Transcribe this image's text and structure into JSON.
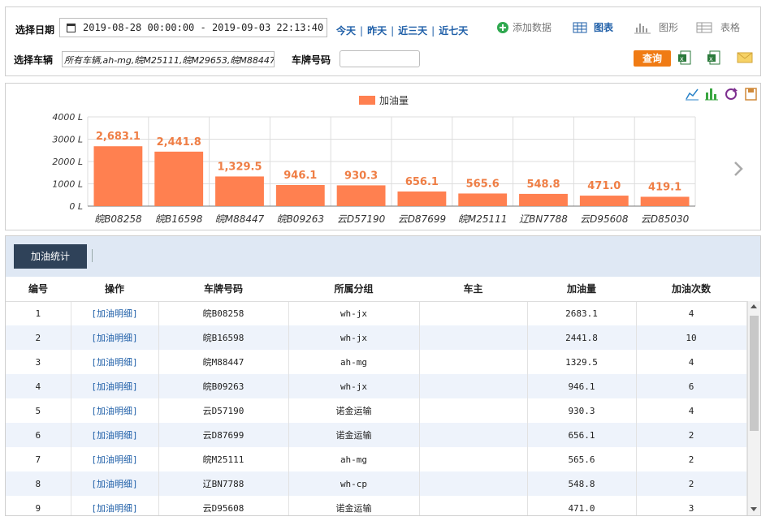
{
  "filter": {
    "date_label": "选择日期",
    "date_range": "2019-08-28 00:00:00 - 2019-09-03 22:13:40",
    "quick": [
      "今天",
      "昨天",
      "近三天",
      "近七天"
    ],
    "add_data": "添加数据",
    "chart_btn": "图表",
    "graph_btn": "图形",
    "table_btn": "表格",
    "vehicle_label": "选择车辆",
    "vehicle_value": "所有车辆,ah-mg,皖M25111,皖M29653,皖M88447",
    "plate_label": "车牌号码",
    "plate_value": "",
    "query": "查询"
  },
  "chart_data": {
    "type": "bar",
    "series": [
      {
        "name": "加油量",
        "values": [
          2683.1,
          2441.8,
          1329.5,
          946.1,
          930.3,
          656.1,
          565.6,
          548.8,
          471.0,
          419.1
        ]
      }
    ],
    "categories": [
      "皖B08258",
      "皖B16598",
      "皖M88447",
      "皖B09263",
      "云D57190",
      "云D87699",
      "皖M25111",
      "辽BN7788",
      "云D95608",
      "云D85030"
    ],
    "value_labels": [
      "2,683.1",
      "2,441.8",
      "1,329.5",
      "946.1",
      "930.3",
      "656.1",
      "565.6",
      "548.8",
      "471.0",
      "419.1"
    ],
    "yticks": [
      "0 L",
      "1000 L",
      "2000 L",
      "3000 L",
      "4000 L"
    ],
    "ylim": [
      0,
      4000
    ],
    "legend_position": "top-center",
    "bar_color": "#ff8050",
    "grid": true
  },
  "table": {
    "tab": "加油统计",
    "headers": [
      "编号",
      "操作",
      "车牌号码",
      "所属分组",
      "车主",
      "加油量",
      "加油次数"
    ],
    "rows": [
      [
        "1",
        "[加油明细]",
        "皖B08258",
        "wh-jx",
        "",
        "2683.1",
        "4"
      ],
      [
        "2",
        "[加油明细]",
        "皖B16598",
        "wh-jx",
        "",
        "2441.8",
        "10"
      ],
      [
        "3",
        "[加油明细]",
        "皖M88447",
        "ah-mg",
        "",
        "1329.5",
        "4"
      ],
      [
        "4",
        "[加油明细]",
        "皖B09263",
        "wh-jx",
        "",
        "946.1",
        "6"
      ],
      [
        "5",
        "[加油明细]",
        "云D57190",
        "诺金运输",
        "",
        "930.3",
        "4"
      ],
      [
        "6",
        "[加油明细]",
        "云D87699",
        "诺金运输",
        "",
        "656.1",
        "2"
      ],
      [
        "7",
        "[加油明细]",
        "皖M25111",
        "ah-mg",
        "",
        "565.6",
        "2"
      ],
      [
        "8",
        "[加油明细]",
        "辽BN7788",
        "wh-cp",
        "",
        "548.8",
        "2"
      ],
      [
        "9",
        "[加油明细]",
        "云D95608",
        "诺金运输",
        "",
        "471.0",
        "3"
      ]
    ]
  }
}
